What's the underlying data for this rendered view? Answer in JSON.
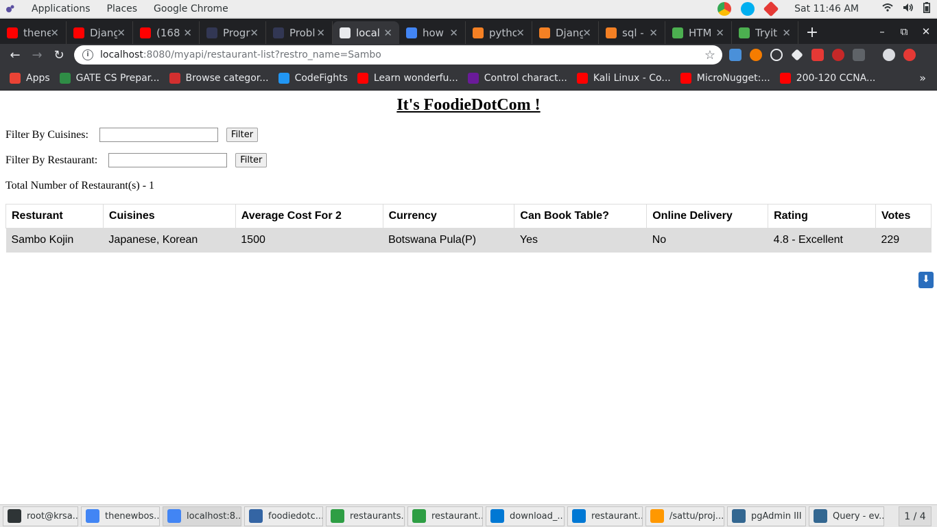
{
  "system_bar": {
    "applications": "Applications",
    "places": "Places",
    "app_name": "Google Chrome",
    "clock": "Sat 11:46 AM"
  },
  "tabs": [
    {
      "label": "thene",
      "icon": "youtube-icon",
      "color": "#ff0000"
    },
    {
      "label": "Djang",
      "icon": "youtube-icon",
      "color": "#ff0000"
    },
    {
      "label": "(168",
      "icon": "youtube-icon",
      "color": "#ff0000"
    },
    {
      "label": "Progr",
      "icon": "hackerearth-icon",
      "color": "#323754"
    },
    {
      "label": "Probl",
      "icon": "hackerearth-icon",
      "color": "#323754"
    },
    {
      "label": "local",
      "icon": "globe-icon",
      "color": "#e8eaed",
      "active": true
    },
    {
      "label": "how",
      "icon": "google-icon",
      "color": "#4285f4"
    },
    {
      "label": "pytho",
      "icon": "stackoverflow-icon",
      "color": "#f48024"
    },
    {
      "label": "Djang",
      "icon": "stackoverflow-icon",
      "color": "#f48024"
    },
    {
      "label": "sql -",
      "icon": "stackoverflow-icon",
      "color": "#f48024"
    },
    {
      "label": "HTM",
      "icon": "w3schools-icon",
      "color": "#4caf50"
    },
    {
      "label": "Tryit",
      "icon": "w3schools-icon",
      "color": "#4caf50"
    }
  ],
  "address_bar": {
    "host": "localhost",
    "path": ":8080/myapi/restaurant-list?restro_name=Sambo"
  },
  "bookmarks": [
    {
      "label": "Apps",
      "icon": "apps-grid-icon",
      "color": "#ea4335"
    },
    {
      "label": "GATE CS Prepar...",
      "icon": "geeksforgeeks-icon",
      "color": "#2f8d46"
    },
    {
      "label": "Browse categor...",
      "icon": "question-icon",
      "color": "#d32f2f"
    },
    {
      "label": "CodeFights",
      "icon": "codefights-icon",
      "color": "#2196f3"
    },
    {
      "label": "Learn wonderfu...",
      "icon": "youtube-icon",
      "color": "#ff0000"
    },
    {
      "label": "Control charact...",
      "icon": "utf-icon",
      "color": "#6a1b9a"
    },
    {
      "label": "Kali Linux - Co...",
      "icon": "youtube-icon",
      "color": "#ff0000"
    },
    {
      "label": "MicroNugget:...",
      "icon": "youtube-icon",
      "color": "#ff0000"
    },
    {
      "label": "200-120 CCNA...",
      "icon": "youtube-icon",
      "color": "#ff0000"
    }
  ],
  "page": {
    "title": "It's FoodieDotCom !",
    "filter_cuisines_label": "Filter By Cuisines:",
    "filter_restaurant_label": "Filter By Restaurant:",
    "filter_button": "Filter",
    "total_text": "Total Number of Restaurant(s) - 1",
    "table": {
      "headers": [
        "Resturant",
        "Cuisines",
        "Average Cost For 2",
        "Currency",
        "Can Book Table?",
        "Online Delivery",
        "Rating",
        "Votes"
      ],
      "rows": [
        [
          "Sambo Kojin",
          "Japanese, Korean",
          "1500",
          "Botswana Pula(P)",
          "Yes",
          "No",
          "4.8 - Excellent",
          "229"
        ]
      ]
    }
  },
  "taskbar": {
    "items": [
      {
        "label": "root@krsa...",
        "icon": "terminal-icon",
        "color": "#2e3436"
      },
      {
        "label": "thenewbos...",
        "icon": "chrome-icon",
        "color": "#4285f4"
      },
      {
        "label": "localhost:8...",
        "icon": "chrome-icon",
        "color": "#4285f4",
        "active": true
      },
      {
        "label": "foodiedotc...",
        "icon": "files-icon",
        "color": "#3465a4"
      },
      {
        "label": "restaurants...",
        "icon": "spreadsheet-icon",
        "color": "#2e9e44"
      },
      {
        "label": "restaurant...",
        "icon": "spreadsheet-icon",
        "color": "#2e9e44"
      },
      {
        "label": "download_...",
        "icon": "vscode-icon",
        "color": "#0078d4"
      },
      {
        "label": "restaurant...",
        "icon": "vscode-icon",
        "color": "#0078d4"
      },
      {
        "label": "/sattu/proj...",
        "icon": "sublime-icon",
        "color": "#ff9800"
      },
      {
        "label": "pgAdmin III",
        "icon": "postgres-icon",
        "color": "#336791"
      },
      {
        "label": "Query - ev...",
        "icon": "postgres-icon",
        "color": "#336791"
      }
    ],
    "pager": "1 / 4"
  }
}
